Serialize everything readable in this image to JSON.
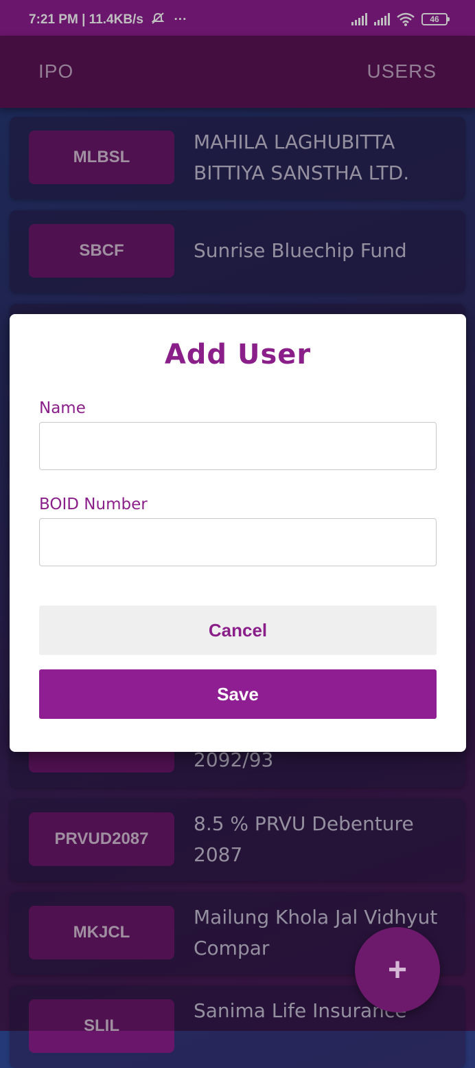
{
  "status_bar": {
    "time_text": "7:21 PM | 11.4KB/s",
    "extra": "···",
    "battery": "46"
  },
  "app_bar": {
    "tab_ipo": "IPO",
    "tab_users": "USERS"
  },
  "ipo_list": [
    {
      "symbol": "MLBSL",
      "name": "MAHILA LAGHUBITTA BITTIYA SANSTHA LTD."
    },
    {
      "symbol": "SBCF",
      "name": "Sunrise Bluechip Fund"
    },
    {
      "symbol": "",
      "name": ""
    },
    {
      "symbol": "",
      "name": ""
    },
    {
      "symbol": "",
      "name": ""
    },
    {
      "symbol": "",
      "name": "2092/93"
    },
    {
      "symbol": "PRVUD2087",
      "name": "8.5 % PRVU Debenture 2087"
    },
    {
      "symbol": "MKJCL",
      "name": "Mailung Khola Jal Vidhyut Compar"
    },
    {
      "symbol": "SLIL",
      "name": "Sanima Life Insurance"
    }
  ],
  "dialog": {
    "title": "Add User",
    "name_label": "Name",
    "name_value": "",
    "boid_label": "BOID Number",
    "boid_value": "",
    "cancel_label": "Cancel",
    "save_label": "Save"
  },
  "fab": {
    "label": "+"
  },
  "colors": {
    "accent": "#8e1e91",
    "app_bar": "#5b1456",
    "symbol_chip": "#6a176b"
  }
}
